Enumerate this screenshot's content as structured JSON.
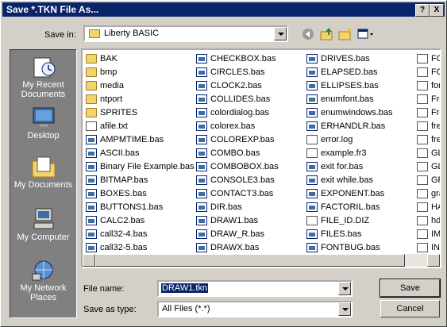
{
  "window": {
    "title": "Save *.TKN File As...",
    "help_btn": "?",
    "close_btn": "X"
  },
  "toolbar": {
    "save_in_label": "Save in:",
    "save_in_accel": "i",
    "save_in_value": "Liberty BASIC"
  },
  "places": [
    {
      "label": "My Recent Documents",
      "icon": "recent-documents-icon"
    },
    {
      "label": "Desktop",
      "icon": "desktop-icon"
    },
    {
      "label": "My Documents",
      "icon": "my-documents-icon"
    },
    {
      "label": "My Computer",
      "icon": "my-computer-icon"
    },
    {
      "label": "My Network Places",
      "icon": "network-places-icon"
    }
  ],
  "files": {
    "col1": [
      "BAK",
      "bmp",
      "media",
      "ntport",
      "SPRITES",
      "afile.txt",
      "AMPMTIME.bas",
      "ASCII.bas",
      "Binary File Example.bas",
      "BITMAP.bas",
      "BOXES.bas",
      "BUTTONS1.bas",
      "CALC2.bas",
      "call32-4.bas",
      "call32-5.bas"
    ],
    "col2": [
      "CHECKBOX.bas",
      "CIRCLES.bas",
      "CLOCK2.bas",
      "COLLIDES.bas",
      "colordialog.bas",
      "colorex.bas",
      "COLOREXP.bas",
      "COMBO.bas",
      "COMBOBOX.bas",
      "CONSOLE3.bas",
      "CONTACT3.bas",
      "DIR.bas",
      "DRAW1.bas",
      "DRAW_R.bas",
      "DRAWX.bas"
    ],
    "col3": [
      "DRIVES.bas",
      "ELAPSED.bas",
      "ELLIPSES.bas",
      "enumfont.bas",
      "enumwindows.bas",
      "ERHANDLR.bas",
      "error.log",
      "example.fr3",
      "exit for.bas",
      "exit while.bas",
      "EXPONENT.bas",
      "FACTORIL.bas",
      "FILE_ID.DIZ",
      "FILES.bas",
      "FONTBUG.bas"
    ],
    "col4": [
      "FO",
      "FO",
      "fon",
      "Fre",
      "Fre",
      "fre",
      "fre",
      "GL",
      "GL",
      "GR",
      "gra",
      "HA",
      "hdi",
      "IMI",
      "IN"
    ]
  },
  "form": {
    "filename_label": "File name:",
    "filename_value": "DRAW1.tkn",
    "type_label": "Save as type:",
    "type_value": "All Files (*.*)"
  },
  "buttons": {
    "save": "Save",
    "cancel": "Cancel"
  }
}
